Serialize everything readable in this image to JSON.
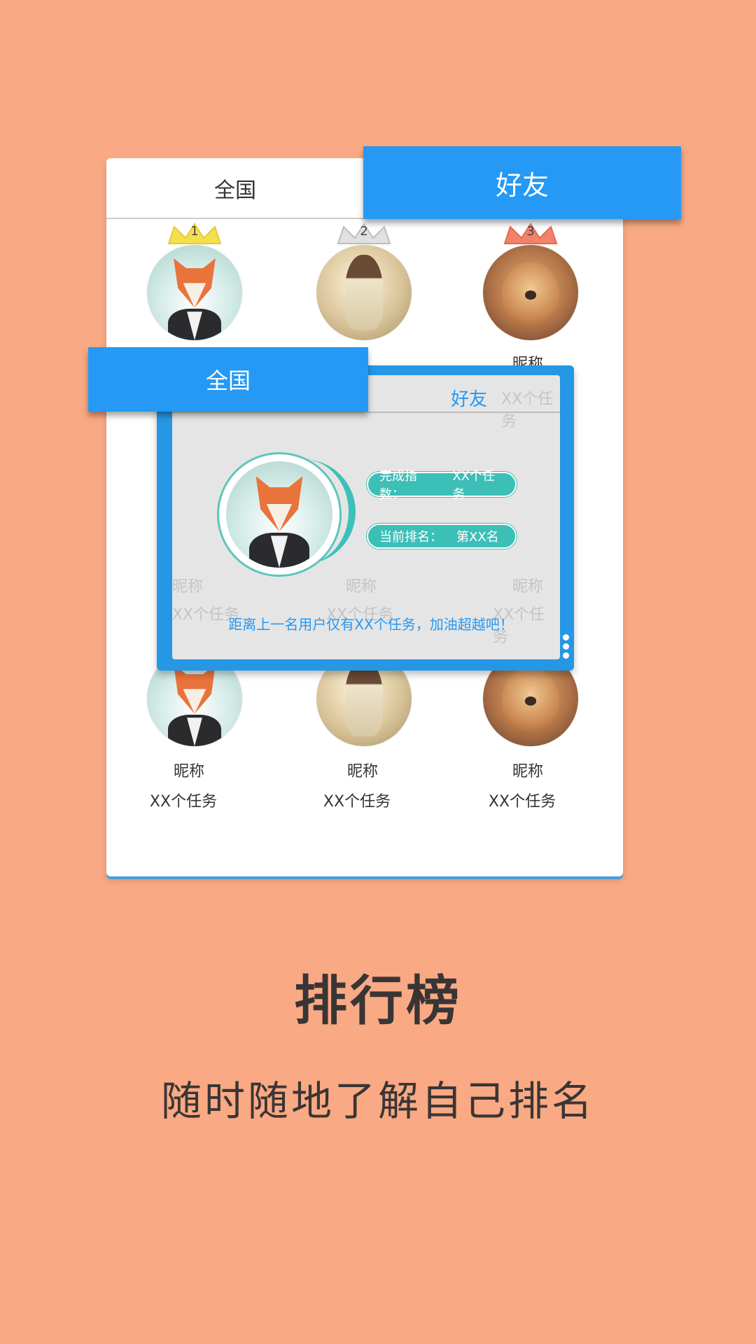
{
  "back_card": {
    "tab_national": "全国",
    "tab_friends": "好友",
    "podium": [
      {
        "rank": "1",
        "crown_color": "#F4E04D",
        "avatar": "fox"
      },
      {
        "rank": "2",
        "crown_color": "#CCCCCC",
        "avatar": "girl"
      },
      {
        "rank": "3",
        "crown_color": "#F2826A",
        "avatar": "dog"
      }
    ],
    "podium_name": "昵称",
    "rows": [
      {
        "name": "昵称",
        "tasks": "XX个任务"
      },
      {
        "name": "昵称",
        "tasks": "XX个任务"
      },
      {
        "name": "昵称",
        "tasks": "XX个任务"
      }
    ]
  },
  "overlay": {
    "tab_national": "全国",
    "tab_friends": "好友",
    "ghost_tab_tasks": "XX个任务",
    "ghost_name": "昵称",
    "ghost_tasks": "XX个任务",
    "completion_label": "完成指数：",
    "completion_value": "XX个任务",
    "rank_label": "当前排名：",
    "rank_value": "第XX名",
    "message": "距离上一名用户仅有XX个任务，加油超越吧！"
  },
  "headline": "排行榜",
  "subline": "随时随地了解自己排名",
  "colors": {
    "background": "#F9A983",
    "accent_blue": "#2599F4",
    "teal": "#3CBFB7",
    "text_dark": "#3A3535"
  },
  "icons": [
    "crown-icon",
    "avatar-fox",
    "avatar-girl",
    "avatar-dog",
    "more-dots-icon"
  ]
}
